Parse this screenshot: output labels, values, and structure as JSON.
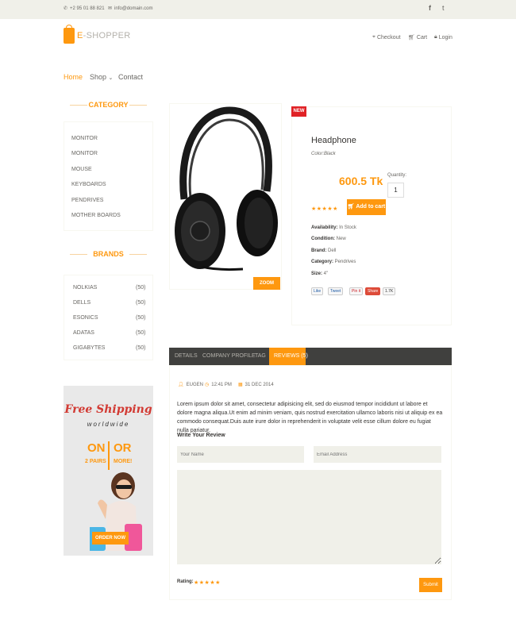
{
  "topbar": {
    "phone": "+2 95 01 88 821",
    "email": "info@domain.com",
    "social": [
      "f",
      "t"
    ]
  },
  "header": {
    "logo_prefix": "E",
    "logo_text": "-SHOPPER",
    "links": [
      {
        "icon": "crosshair-icon",
        "label": "Checkout"
      },
      {
        "icon": "cart-icon",
        "label": "Cart"
      },
      {
        "icon": "lock-icon",
        "label": "Login"
      }
    ]
  },
  "nav": {
    "home": "Home",
    "shop": "Shop",
    "contact": "Contact"
  },
  "sidebar": {
    "category_title": "CATEGORY",
    "categories": [
      "MONITOR",
      "MONITOR",
      "MOUSE",
      "KEYBOARDS",
      "PENDRIVES",
      "MOTHER BOARDS"
    ],
    "brands_title": "BRANDS",
    "brands": [
      {
        "name": "NOLKIAS",
        "count": "(50)"
      },
      {
        "name": "DELLS",
        "count": "(50)"
      },
      {
        "name": "ESONICS",
        "count": "(50)"
      },
      {
        "name": "ADATAS",
        "count": "(50)"
      },
      {
        "name": "GIGABYTES",
        "count": "(50)"
      }
    ],
    "ad": {
      "title": "Free Shipping",
      "subtitle": "worldwide",
      "on": "ON",
      "or": "OR",
      "pairs": "2 PAIRS",
      "more": "MORE!",
      "button": "ORDER NOW"
    }
  },
  "product": {
    "badge": "NEW",
    "zoom": "ZOOM",
    "name": "Headphone",
    "color": "Color:Black",
    "price": "600.5 Tk",
    "quantity_label": "Quantity:",
    "quantity": "1",
    "rating_stars": "★★★★★",
    "add_to_cart": "Add to cart",
    "specs": [
      {
        "label": "Availability:",
        "value": " In Stock"
      },
      {
        "label": "Condition:",
        "value": " New"
      },
      {
        "label": "Brand:",
        "value": " Dell"
      },
      {
        "label": "Category:",
        "value": " Pendrives"
      },
      {
        "label": "Size:",
        "value": " 4\""
      }
    ],
    "share": [
      "Like",
      "Tweet",
      "Pin it",
      "Share",
      "1.7K"
    ]
  },
  "tabs": {
    "items": [
      "DETAILS",
      "COMPANY PROFILE",
      "TAG",
      "REVIEWS (5)"
    ],
    "active": "REVIEWS (5)"
  },
  "review": {
    "author": "EUGEN",
    "time": "12:41 PM",
    "date": "31 DEC 2014",
    "text": "Lorem ipsum dolor sit amet, consectetur adipisicing elit, sed do eiusmod tempor incididunt ut labore et dolore magna aliqua.Ut enim ad minim veniam, quis nostrud exercitation ullamco laboris nisi ut aliquip ex ea commodo consequat.Duis aute irure dolor in reprehenderit in voluptate velit esse cillum dolore eu fugiat nulla pariatur.",
    "write_label": "Write Your Review",
    "name_placeholder": "Your Name",
    "email_placeholder": "Email Address",
    "rating_label": "Rating:",
    "rating_stars": "★★★★★",
    "submit": "Submit"
  },
  "colors": {
    "accent": "#fe980f",
    "badge_red": "#e02226",
    "tab_dark": "#40403e",
    "field_bg": "#f0f0e9"
  }
}
